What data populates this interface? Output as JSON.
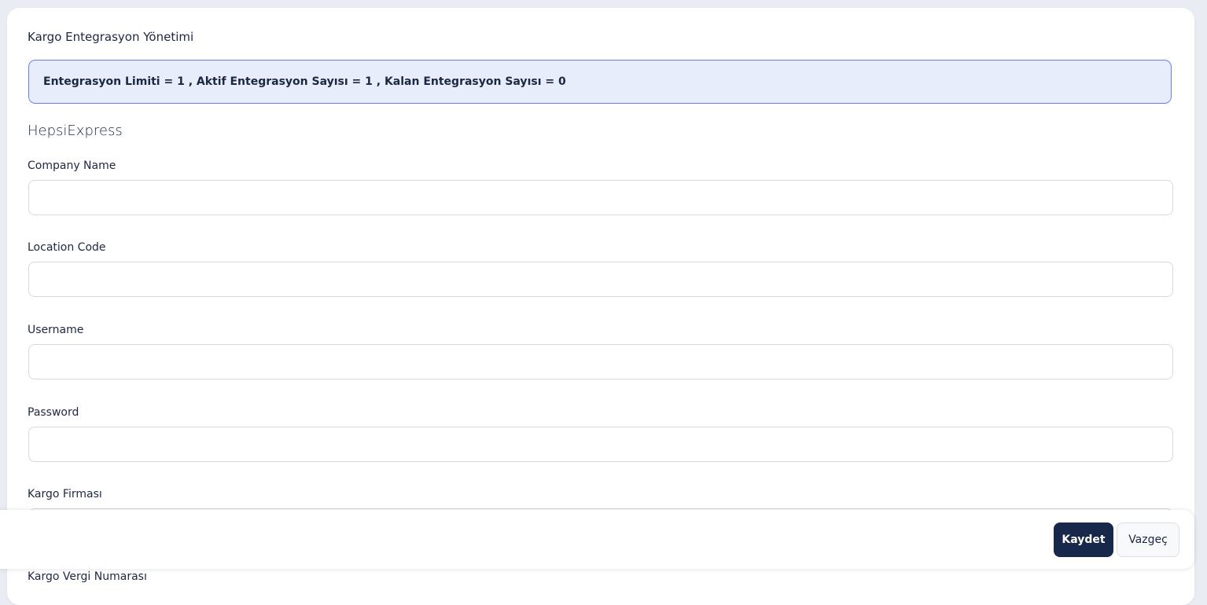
{
  "page": {
    "title": "Kargo Entegrasyon Yönetimi"
  },
  "alert": {
    "text": "Entegrasyon Limiti = 1 , Aktif Entegrasyon Sayısı = 1 , Kalan Entegrasyon Sayısı = 0"
  },
  "section": {
    "title": "HepsiExpress"
  },
  "form": {
    "company_name": {
      "label": "Company Name",
      "value": ""
    },
    "location_code": {
      "label": "Location Code",
      "value": ""
    },
    "username": {
      "label": "Username",
      "value": ""
    },
    "password": {
      "label": "Password",
      "value": ""
    },
    "kargo_firmasi": {
      "label": "Kargo Firması",
      "value": ""
    },
    "kargo_vergi_numarasi": {
      "label": "Kargo Vergi Numarası"
    }
  },
  "footer": {
    "save_label": "Kaydet",
    "cancel_label": "Vazgeç"
  }
}
